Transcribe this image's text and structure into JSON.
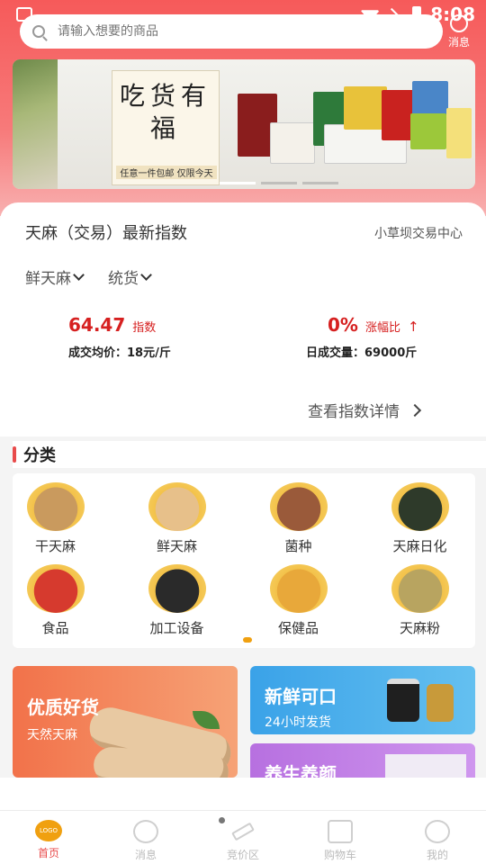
{
  "status": {
    "time": "8:08"
  },
  "search": {
    "placeholder": "请输入想要的商品"
  },
  "header": {
    "message_label": "消息"
  },
  "banner": {
    "title": "吃货有福",
    "subtitle": "任意一件包邮 仅限今天"
  },
  "index": {
    "title": "天麻（交易）最新指数",
    "center": "小草坝交易中心",
    "filter_type": "鲜天麻",
    "filter_grade": "统货",
    "index_value": "64.47",
    "index_tag": "指数",
    "avg_price_label": "成交均价：",
    "avg_price_value": "18元/斤",
    "change_value": "0%",
    "change_tag": "涨幅比",
    "volume_label": "日成交量：",
    "volume_value": "69000斤",
    "detail_link": "查看指数详情"
  },
  "categories": {
    "title": "分类",
    "items": [
      {
        "label": "干天麻",
        "color": "#c99a5e"
      },
      {
        "label": "鲜天麻",
        "color": "#e7c08a"
      },
      {
        "label": "菌种",
        "color": "#9a5a3a"
      },
      {
        "label": "天麻日化",
        "color": "#2e3a2a"
      },
      {
        "label": "食品",
        "color": "#d63a2e"
      },
      {
        "label": "加工设备",
        "color": "#2a2a2a"
      },
      {
        "label": "保健品",
        "color": "#e8a83a"
      },
      {
        "label": "天麻粉",
        "color": "#b8a460"
      }
    ]
  },
  "promos": {
    "left_title": "优质好货",
    "left_sub": "天然天麻",
    "right_top_title": "新鲜可口",
    "right_top_sub": "24小时发货",
    "right_bottom_title": "养生养颜"
  },
  "tabs": [
    {
      "label": "首页",
      "active": true,
      "icon": "logo-icon"
    },
    {
      "label": "消息",
      "active": false,
      "icon": "chat-icon"
    },
    {
      "label": "竞价区",
      "active": false,
      "icon": "auction-hammer-icon"
    },
    {
      "label": "购物车",
      "active": false,
      "icon": "shopping-bag-icon"
    },
    {
      "label": "我的",
      "active": false,
      "icon": "profile-icon"
    }
  ],
  "logo_text": "LOGO"
}
